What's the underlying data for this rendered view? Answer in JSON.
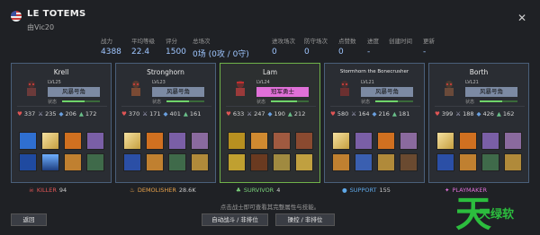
{
  "team": {
    "name": "LE TOTEMS",
    "owner": "由Vic20"
  },
  "close_icon": "✕",
  "stats": [
    {
      "label": "战力",
      "value": "4388"
    },
    {
      "label": "平均等级",
      "value": "22.4"
    },
    {
      "label": "评分",
      "value": "1500"
    },
    {
      "label": "总场次",
      "value": "0场 (0攻 / 0守)"
    },
    {
      "label": "进攻场次",
      "value": "0"
    },
    {
      "label": "防守场次",
      "value": "0"
    },
    {
      "label": "点赞数",
      "value": "0"
    },
    {
      "label": "进度",
      "value": "-"
    },
    {
      "label": "创建时间",
      "value": ""
    },
    {
      "label": "更新",
      "value": "-"
    }
  ],
  "heroes": [
    {
      "name": "Krell",
      "level": "LVL25",
      "role": "风暴号角",
      "status": "状态",
      "hp": "337",
      "atk": "235",
      "def": "206",
      "spd": "172",
      "hp_fill": 0.6
    },
    {
      "name": "Stronghorn",
      "level": "LVL23",
      "role": "风暴号角",
      "status": "状态",
      "hp": "370",
      "atk": "171",
      "def": "401",
      "spd": "161",
      "hp_fill": 0.6
    },
    {
      "name": "Lam",
      "level": "LVL24",
      "role": "冠军勇士",
      "status": "状态",
      "hp": "633",
      "atk": "247",
      "def": "190",
      "spd": "212",
      "hp_fill": 0.7
    },
    {
      "name": "Stormhorn the Bonecrusher",
      "level": "LVL21",
      "role": "风暴号角",
      "status": "状态",
      "hp": "580",
      "atk": "164",
      "def": "216",
      "spd": "181",
      "hp_fill": 0.6
    },
    {
      "name": "Borth",
      "level": "LVL21",
      "role": "风暴号角",
      "status": "状态",
      "hp": "399",
      "atk": "188",
      "def": "426",
      "spd": "162",
      "hp_fill": 0.6
    }
  ],
  "titles": [
    {
      "label": "KILLER",
      "value": "94",
      "icon": "skull-icon"
    },
    {
      "label": "DEMOLISHER",
      "value": "28.6K",
      "icon": "fire-icon"
    },
    {
      "label": "SURVIVOR",
      "value": "4",
      "icon": "sprout-icon"
    },
    {
      "label": "SUPPORT",
      "value": "155",
      "icon": "drop-icon"
    },
    {
      "label": "PLAYMAKER",
      "value": "",
      "icon": "star-icon"
    }
  ],
  "hint": "点击战士即可查看其完整属性与技能。",
  "buttons": {
    "back": "返回",
    "auto": "自动战斗 / 非排位",
    "manual": "操控 / 非排位"
  },
  "watermark": {
    "char": "天",
    "text": "天绿软"
  },
  "colors": {
    "accent_blue": "#9fc6ff",
    "card_border": "#4a5f7a",
    "highlight_border": "#6fb24a",
    "role_default": "#7c8aa3",
    "role_champion": "#e070d8"
  }
}
